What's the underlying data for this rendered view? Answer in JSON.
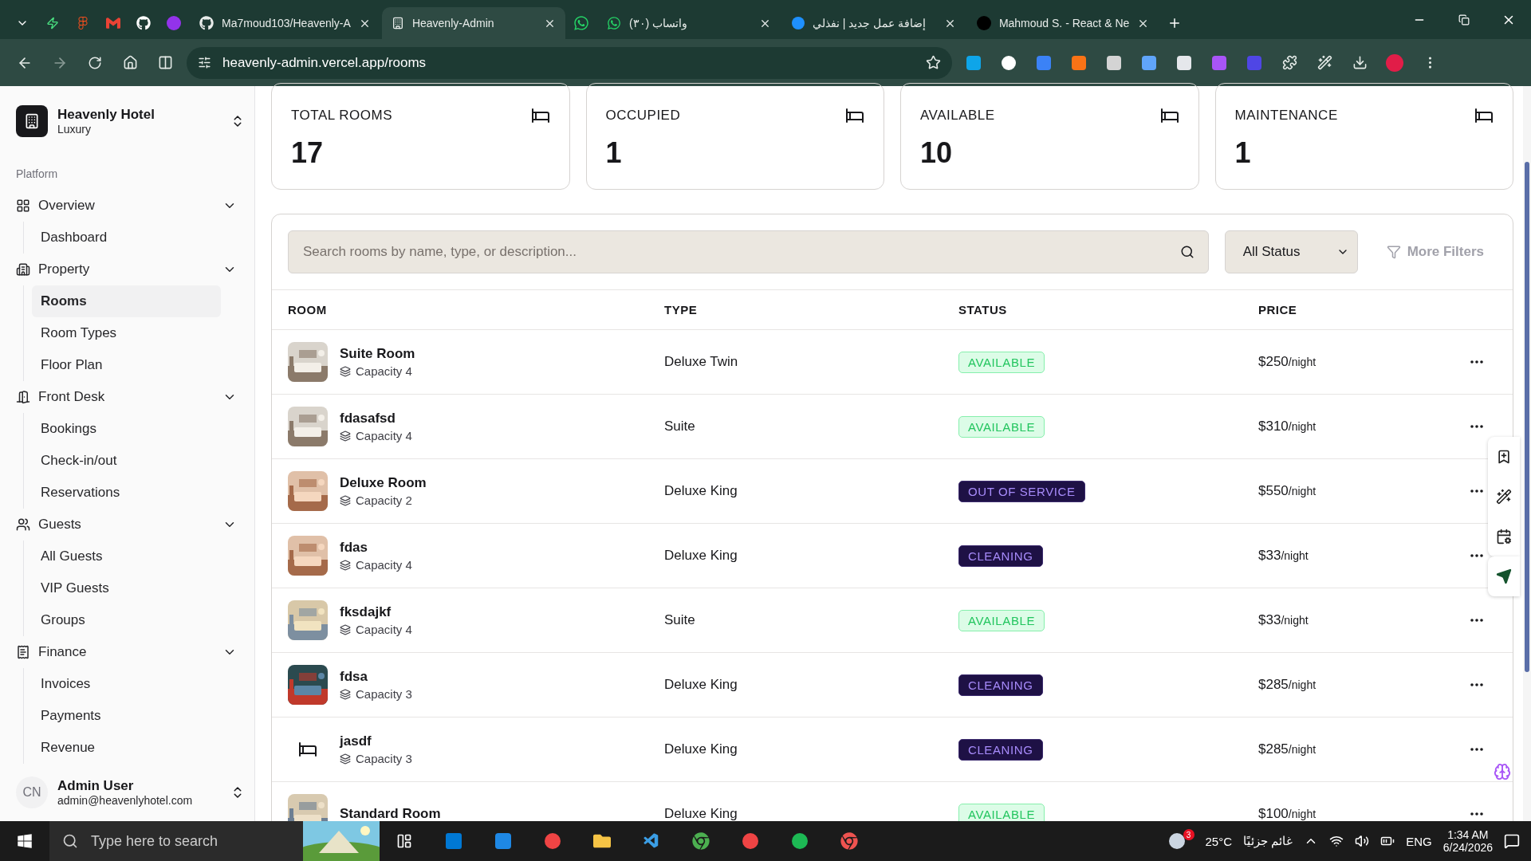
{
  "browser": {
    "tabs": [
      {
        "title": "Ma7moud103/Heavenly-A",
        "selected": false
      },
      {
        "title": "Heavenly-Admin",
        "selected": true
      },
      {
        "title": "(٣٠) واتساب",
        "selected": false
      },
      {
        "title": "إضافة عمل جديد | نفذلي",
        "selected": false
      },
      {
        "title": "Mahmoud S. - React & Ne",
        "selected": false
      }
    ],
    "url": "heavenly-admin.vercel.app/rooms"
  },
  "sidebar": {
    "team": {
      "name": "Heavenly Hotel",
      "plan": "Luxury"
    },
    "section_label": "Platform",
    "groups": [
      {
        "label": "Overview",
        "expanded": true,
        "children": [
          {
            "label": "Dashboard",
            "selected": false
          }
        ]
      },
      {
        "label": "Property",
        "expanded": true,
        "children": [
          {
            "label": "Rooms",
            "selected": true
          },
          {
            "label": "Room Types",
            "selected": false
          },
          {
            "label": "Floor Plan",
            "selected": false
          }
        ]
      },
      {
        "label": "Front Desk",
        "expanded": true,
        "children": [
          {
            "label": "Bookings",
            "selected": false
          },
          {
            "label": "Check-in/out",
            "selected": false
          },
          {
            "label": "Reservations",
            "selected": false
          }
        ]
      },
      {
        "label": "Guests",
        "expanded": true,
        "children": [
          {
            "label": "All Guests",
            "selected": false
          },
          {
            "label": "VIP Guests",
            "selected": false
          },
          {
            "label": "Groups",
            "selected": false
          }
        ]
      },
      {
        "label": "Finance",
        "expanded": true,
        "children": [
          {
            "label": "Invoices",
            "selected": false
          },
          {
            "label": "Payments",
            "selected": false
          },
          {
            "label": "Revenue",
            "selected": false
          }
        ]
      }
    ],
    "user": {
      "initials": "CN",
      "name": "Admin User",
      "email": "admin@heavenlyhotel.com"
    }
  },
  "stats": [
    {
      "label": "TOTAL ROOMS",
      "value": "17"
    },
    {
      "label": "OCCUPIED",
      "value": "1"
    },
    {
      "label": "AVAILABLE",
      "value": "10"
    },
    {
      "label": "MAINTENANCE",
      "value": "1"
    }
  ],
  "search": {
    "placeholder": "Search rooms by name, type, or description..."
  },
  "status_filter": {
    "value": "All Status"
  },
  "more_filters": "More Filters",
  "table": {
    "columns": [
      "ROOM",
      "TYPE",
      "STATUS",
      "PRICE"
    ],
    "rows": [
      {
        "kind": "picture",
        "name": "Suite Room",
        "capacity": "Capacity 4",
        "type": "Deluxe Twin",
        "status": {
          "label": "AVAILABLE",
          "kind": "available"
        },
        "price": "$250",
        "unit": "/night"
      },
      {
        "kind": "picture",
        "name": "fdasafsd",
        "capacity": "Capacity 4",
        "type": "Suite",
        "status": {
          "label": "AVAILABLE",
          "kind": "available"
        },
        "price": "$310",
        "unit": "/night"
      },
      {
        "kind": "picture",
        "name": "Deluxe Room",
        "capacity": "Capacity 2",
        "type": "Deluxe King",
        "status": {
          "label": "OUT OF SERVICE",
          "kind": "out_of_service"
        },
        "price": "$550",
        "unit": "/night"
      },
      {
        "kind": "picture",
        "name": "fdas",
        "capacity": "Capacity 4",
        "type": "Deluxe King",
        "status": {
          "label": "CLEANING",
          "kind": "cleaning"
        },
        "price": "$33",
        "unit": "/night"
      },
      {
        "kind": "picture",
        "name": "fksdajkf",
        "capacity": "Capacity 4",
        "type": "Suite",
        "status": {
          "label": "AVAILABLE",
          "kind": "available"
        },
        "price": "$33",
        "unit": "/night"
      },
      {
        "kind": "picture",
        "name": "fdsa",
        "capacity": "Capacity 3",
        "type": "Deluxe King",
        "status": {
          "label": "CLEANING",
          "kind": "cleaning"
        },
        "price": "$285",
        "unit": "/night"
      },
      {
        "kind": "icon",
        "name": "jasdf",
        "capacity": "Capacity 3",
        "type": "Deluxe King",
        "status": {
          "label": "CLEANING",
          "kind": "cleaning"
        },
        "price": "$285",
        "unit": "/night"
      },
      {
        "kind": "picture",
        "name": "Standard Room",
        "type": "Deluxe King",
        "status": {
          "label": "AVAILABLE",
          "kind": "available"
        },
        "price": "$100",
        "unit": "/night"
      }
    ]
  },
  "taskbar": {
    "search_placeholder": "Type here to search",
    "temperature": "25°C",
    "weather": "غائم جزئيًا",
    "weather_badge": "3",
    "language": "ENG",
    "time": "1:34 AM",
    "date": "6/24/2026"
  }
}
